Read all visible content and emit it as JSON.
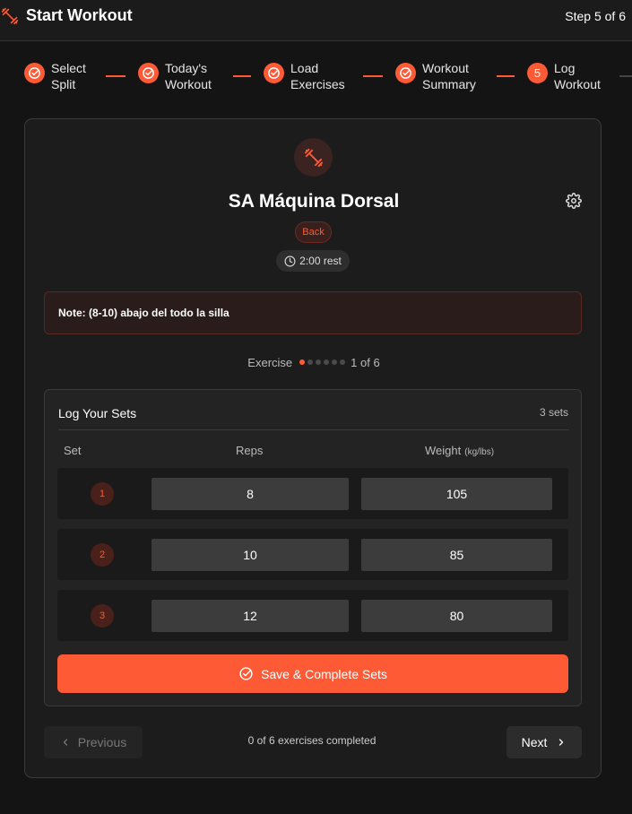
{
  "header": {
    "title": "Start Workout",
    "step_text": "Step 5 of 6"
  },
  "stepper": {
    "steps": [
      {
        "label_line1": "Select",
        "label_line2": "Split",
        "state": "done"
      },
      {
        "label_line1": "Today's",
        "label_line2": "Workout",
        "state": "done"
      },
      {
        "label_line1": "Load",
        "label_line2": "Exercises",
        "state": "done"
      },
      {
        "label_line1": "Workout",
        "label_line2": "Summary",
        "state": "done"
      },
      {
        "number": "5",
        "label_line1": "Log",
        "label_line2": "Workout",
        "state": "current"
      }
    ]
  },
  "exercise": {
    "name": "SA Máquina Dorsal",
    "muscle_badge": "Back",
    "rest": "2:00 rest",
    "note": "Note: (8-10) abajo del todo la silla",
    "icon": "dumbbell-icon"
  },
  "progress": {
    "label": "Exercise",
    "counter": "1 of 6",
    "total_dots": 6,
    "active_index": 0
  },
  "sets_panel": {
    "title": "Log Your Sets",
    "count": "3 sets",
    "col_set": "Set",
    "col_reps": "Reps",
    "col_weight": "Weight",
    "col_weight_unit": "(kg/lbs)",
    "rows": [
      {
        "set": "1",
        "reps": "8",
        "weight": "105"
      },
      {
        "set": "2",
        "reps": "10",
        "weight": "85"
      },
      {
        "set": "3",
        "reps": "12",
        "weight": "80"
      }
    ],
    "save_label": "Save & Complete Sets"
  },
  "footer": {
    "prev_label": "Previous",
    "next_label": "Next",
    "completed_text": "0 of 6 exercises completed"
  },
  "colors": {
    "accent": "#ff5a36",
    "background": "#141414",
    "card": "#1c1c1c"
  }
}
